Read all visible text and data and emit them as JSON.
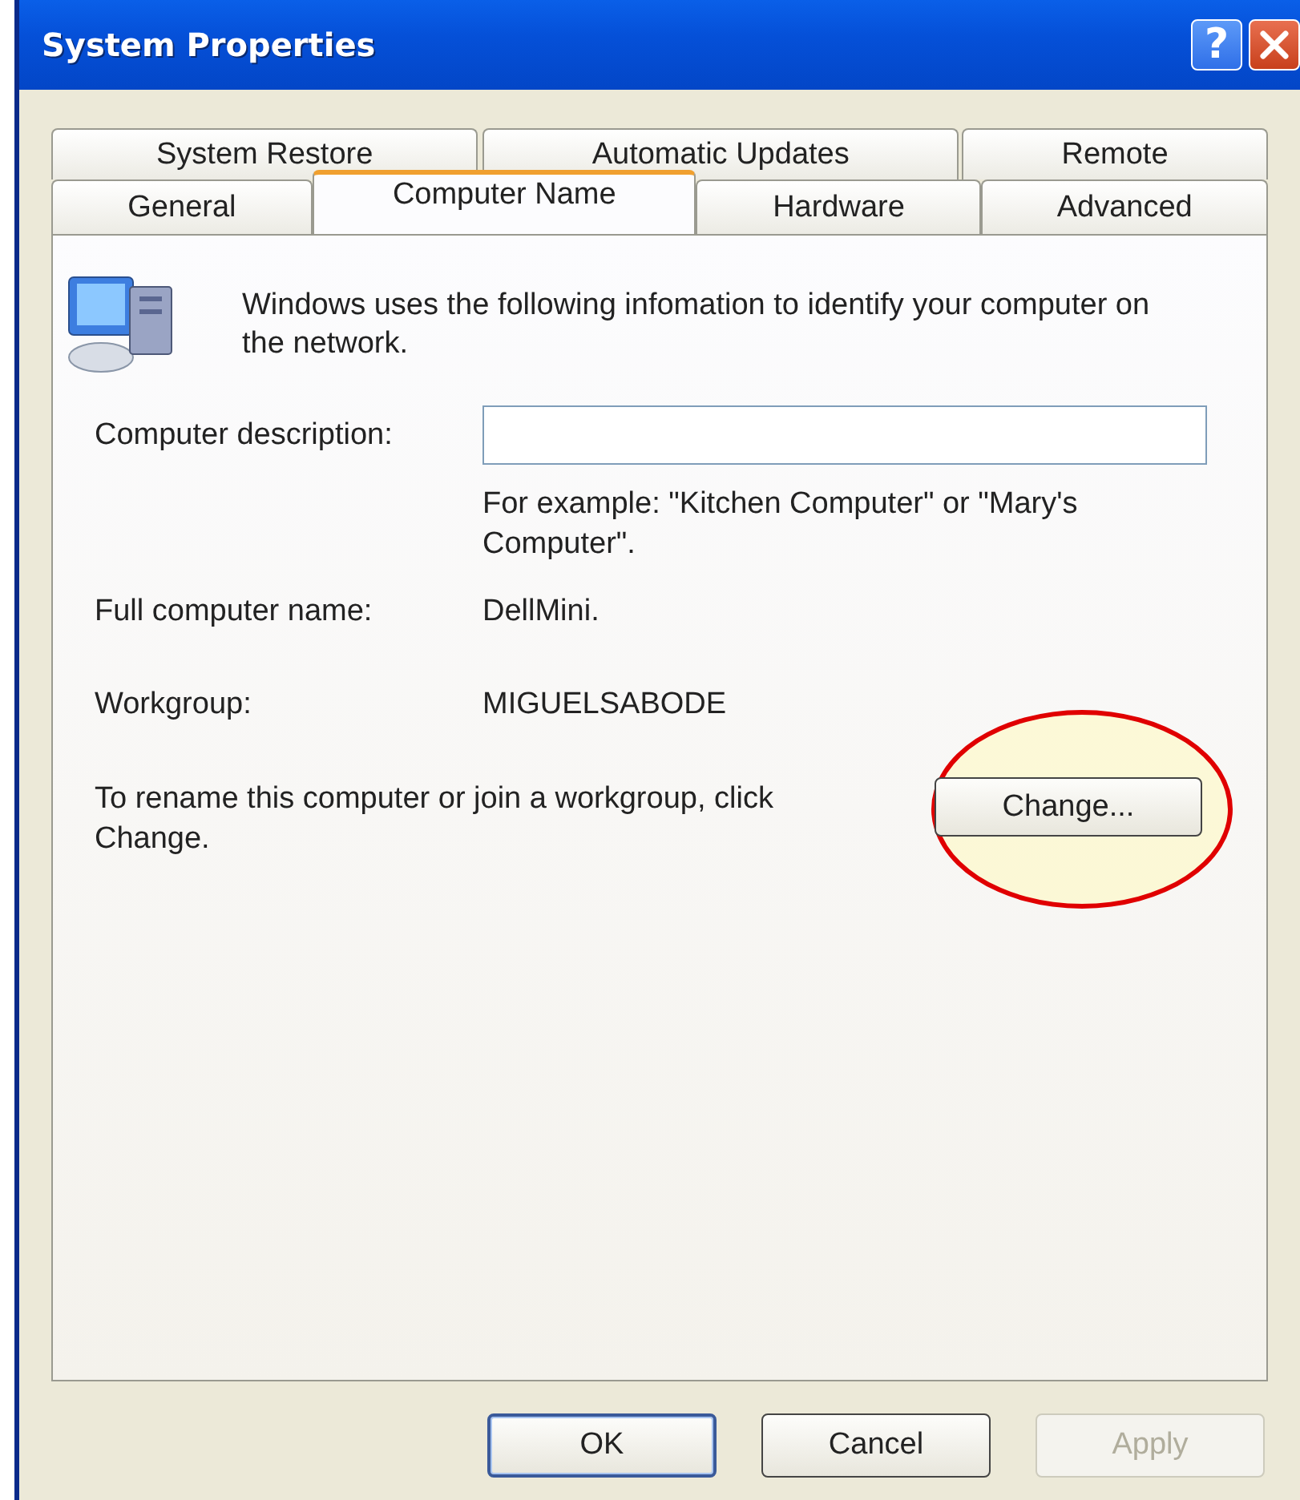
{
  "window": {
    "title": "System Properties"
  },
  "title_buttons": [
    {
      "kind": "help",
      "label": "?"
    },
    {
      "kind": "close"
    }
  ],
  "tab_rows": [
    {
      "tabs": [
        {
          "label": "System Restore",
          "selected": false
        },
        {
          "label": "Automatic Updates",
          "selected": false
        },
        {
          "label": "Remote",
          "selected": false
        }
      ]
    },
    {
      "tabs": [
        {
          "label": "General",
          "selected": false
        },
        {
          "label": "Computer Name",
          "selected": true
        },
        {
          "label": "Hardware",
          "selected": false
        },
        {
          "label": "Advanced",
          "selected": false
        }
      ]
    }
  ],
  "intro": "Windows uses the following infomation to identify your computer on the network.",
  "description": {
    "label": "Computer description:"
  },
  "hint": "For example: \"Kitchen Computer\" or \"Mary's Computer\".",
  "info_rows": [
    {
      "label": "Full computer name:",
      "value": "DellMini."
    },
    {
      "label": "Workgroup:",
      "value": "MIGUELSABODE"
    }
  ],
  "rename": {
    "text": "To rename this computer or join a workgroup, click Change.",
    "button": "Change...",
    "highlighted": true
  },
  "buttons": [
    {
      "label": "OK",
      "default": true,
      "disabled": false
    },
    {
      "label": "Cancel",
      "default": false,
      "disabled": false
    },
    {
      "label": "Apply",
      "default": false,
      "disabled": true
    }
  ]
}
